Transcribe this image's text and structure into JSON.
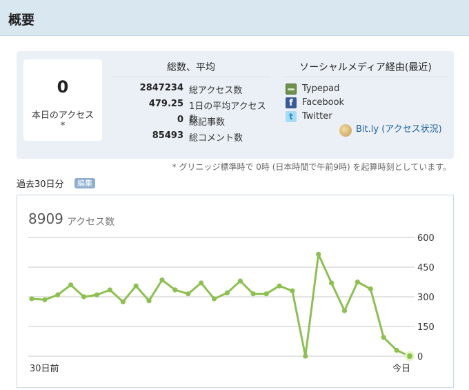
{
  "header": {
    "title": "概要"
  },
  "today": {
    "value": "0",
    "label": "本日のアクセス",
    "note": "*"
  },
  "totals": {
    "title": "総数、平均",
    "rows": [
      {
        "value": "2847234",
        "label": "総アクセス数"
      },
      {
        "value": "479.25",
        "label": "1日の平均アクセス数"
      },
      {
        "value": "0",
        "label": "総記事数"
      },
      {
        "value": "85493",
        "label": "総コメント数"
      }
    ]
  },
  "social": {
    "title": "ソーシャルメディア経由(最近)",
    "items": [
      {
        "label": "Typepad",
        "icon": "typepad-icon"
      },
      {
        "label": "Facebook",
        "icon": "facebook-icon"
      },
      {
        "label": "Twitter",
        "icon": "twitter-icon"
      }
    ],
    "bitly": {
      "label": "Bit.ly (アクセス状況)",
      "icon": "bitly-icon"
    }
  },
  "gmt_note": "* グリニッジ標準時で 0時 (日本時間で午前9時) を起算時刻としています。",
  "period": {
    "label": "過去30日分",
    "edit_label": "編集"
  },
  "chart_data": {
    "type": "line",
    "total": "8909",
    "total_label": "アクセス数",
    "x_start_label": "30日前",
    "x_end_label": "今日",
    "ylim": [
      0,
      600
    ],
    "yticks": [
      "600",
      "450",
      "300",
      "150",
      "0"
    ],
    "grid": true,
    "color": "#8cc04f",
    "values": [
      290,
      285,
      310,
      360,
      300,
      310,
      335,
      275,
      355,
      280,
      385,
      335,
      315,
      370,
      290,
      320,
      380,
      315,
      315,
      355,
      330,
      0,
      515,
      370,
      230,
      375,
      340,
      95,
      30,
      0
    ]
  }
}
